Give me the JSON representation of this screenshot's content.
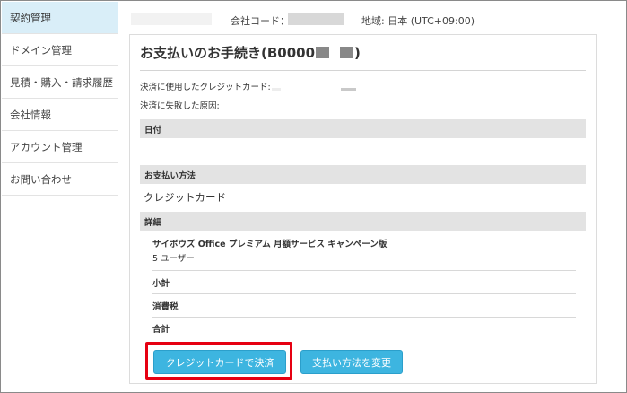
{
  "sidebar": {
    "items": [
      {
        "label": "契約管理"
      },
      {
        "label": "ドメイン管理"
      },
      {
        "label": "見積・購入・請求履歴"
      },
      {
        "label": "会社情報"
      },
      {
        "label": "アカウント管理"
      },
      {
        "label": "お問い合わせ"
      }
    ]
  },
  "topbar": {
    "company_code_label": "会社コード：",
    "region_label": "地域: 日本 (UTC+09:00)"
  },
  "payment": {
    "title_prefix": "お支払いのお手続き(B0000",
    "title_suffix": ")",
    "card_used_label": "決済に使用したクレジットカード:",
    "failure_reason_label": "決済に失敗した原因:",
    "date_header": "日付",
    "method_header": "お支払い方法",
    "method_value": "クレジットカード",
    "detail_header": "詳細",
    "product_name": "サイボウズ Office プレミアム 月額サービス キャンペーン版",
    "user_count": "5 ユーザー",
    "subtotal_label": "小計",
    "tax_label": "消費税",
    "total_label": "合計"
  },
  "buttons": {
    "pay_by_card": "クレジットカードで決済",
    "change_method": "支払い方法を変更"
  },
  "colors": {
    "accent_button": "#3db5e0",
    "highlight_border": "#e60012",
    "sidebar_active": "#d9eef8"
  }
}
